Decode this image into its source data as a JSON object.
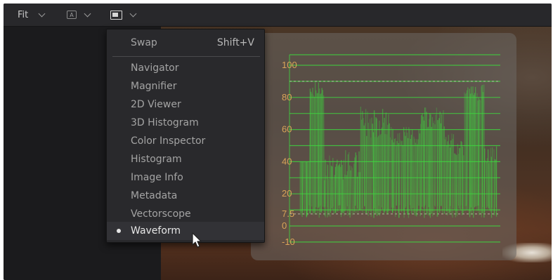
{
  "toolbar": {
    "fit_label": "Fit",
    "ab_label": "A"
  },
  "menu": {
    "swap": {
      "label": "Swap",
      "shortcut": "Shift+V"
    },
    "items": [
      {
        "label": "Navigator"
      },
      {
        "label": "Magnifier"
      },
      {
        "label": "2D Viewer"
      },
      {
        "label": "3D Histogram"
      },
      {
        "label": "Color Inspector"
      },
      {
        "label": "Histogram"
      },
      {
        "label": "Image Info"
      },
      {
        "label": "Metadata"
      },
      {
        "label": "Vectorscope"
      },
      {
        "label": "Waveform",
        "selected": true
      }
    ]
  },
  "waveform": {
    "scale_labels": [
      "100",
      "80",
      "60",
      "40",
      "20",
      "7.5",
      "0",
      "-10"
    ],
    "trace_color": "#3fd63f"
  },
  "icons": {
    "fit_chevron": "chevron-down-icon",
    "ab_compare": "ab-compare-icon",
    "viewer_layout": "viewer-layout-icon",
    "cursor": "mouse-pointer-icon"
  }
}
